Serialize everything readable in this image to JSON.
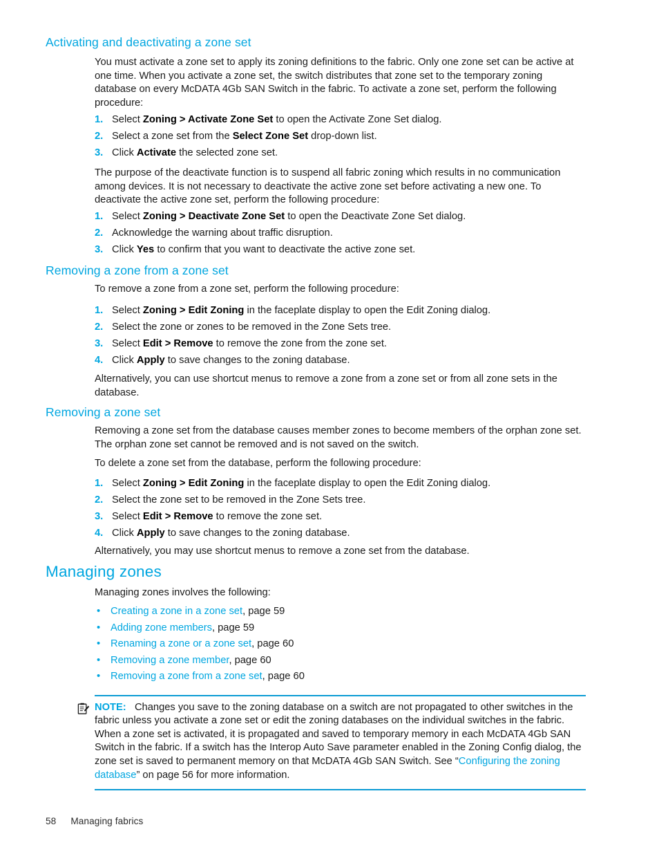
{
  "colors": {
    "accent": "#00a6e0",
    "rule": "#0a9bd4",
    "body_text": "#1a1a1a"
  },
  "sections": [
    {
      "id": "activating-deactivating",
      "heading": "Activating and deactivating a zone set",
      "intro": "You must activate a zone set to apply its zoning definitions to the fabric. Only one zone set can be active at one time. When you activate a zone set, the switch distributes that zone set to the temporary zoning database on every McDATA 4Gb SAN Switch in the fabric. To activate a zone set, perform the following procedure:",
      "steps": [
        {
          "num": "1.",
          "pre": "Select ",
          "bold": "Zoning > Activate Zone Set",
          "post": " to open the Activate Zone Set dialog."
        },
        {
          "num": "2.",
          "pre": "Select a zone set from the ",
          "bold": "Select Zone Set",
          "post": " drop-down list."
        },
        {
          "num": "3.",
          "pre": "Click ",
          "bold": "Activate",
          "post": " the selected zone set."
        }
      ],
      "middle": "The purpose of the deactivate function is to suspend all fabric zoning which results in no communication among devices. It is not necessary to deactivate the active zone set before activating a new one. To deactivate the active zone set, perform the following procedure:",
      "steps2": [
        {
          "num": "1.",
          "pre": "Select ",
          "bold": "Zoning > Deactivate Zone Set",
          "post": " to open the Deactivate Zone Set dialog."
        },
        {
          "num": "2.",
          "pre": "Acknowledge the warning about traffic disruption.",
          "bold": "",
          "post": ""
        },
        {
          "num": "3.",
          "pre": "Click ",
          "bold": "Yes",
          "post": " to confirm that you want to deactivate the active zone set."
        }
      ]
    },
    {
      "id": "removing-zone-from-zone-set",
      "heading": "Removing a zone from a zone set",
      "intro": "To remove a zone from a zone set, perform the following procedure:",
      "steps": [
        {
          "num": "1.",
          "pre": "Select ",
          "bold": "Zoning > Edit Zoning",
          "post": " in the faceplate display to open the Edit Zoning dialog."
        },
        {
          "num": "2.",
          "pre": "Select the zone or zones to be removed in the Zone Sets tree.",
          "bold": "",
          "post": ""
        },
        {
          "num": "3.",
          "pre": "Select ",
          "bold": "Edit > Remove",
          "post": " to remove the zone from the zone set."
        },
        {
          "num": "4.",
          "pre": "Click ",
          "bold": "Apply",
          "post": " to save changes to the zoning database."
        }
      ],
      "outro": "Alternatively, you can use shortcut menus to remove a zone from a zone set or from all zone sets in the database."
    },
    {
      "id": "removing-zone-set",
      "heading": "Removing a zone set",
      "intro": "Removing a zone set from the database causes member zones to become members of the orphan zone set. The orphan zone set cannot be removed and is not saved on the switch.",
      "intro2": "To delete a zone set from the database, perform the following procedure:",
      "steps": [
        {
          "num": "1.",
          "pre": "Select ",
          "bold": "Zoning > Edit Zoning",
          "post": " in the faceplate display to open the Edit Zoning dialog."
        },
        {
          "num": "2.",
          "pre": "Select the zone set to be removed in the Zone Sets tree.",
          "bold": "",
          "post": ""
        },
        {
          "num": "3.",
          "pre": "Select ",
          "bold": "Edit > Remove",
          "post": " to remove the zone set."
        },
        {
          "num": "4.",
          "pre": "Click ",
          "bold": "Apply",
          "post": " to save changes to the zoning database."
        }
      ],
      "outro": "Alternatively, you may use shortcut menus to remove a zone set from the database."
    }
  ],
  "managing_zones": {
    "heading": "Managing zones",
    "intro": "Managing zones involves the following:",
    "links": [
      {
        "label": "Creating a zone in a zone set",
        "page": ", page 59"
      },
      {
        "label": "Adding zone members",
        "page": ", page 59"
      },
      {
        "label": "Renaming a zone or a zone set",
        "page": ", page 60"
      },
      {
        "label": "Removing a zone member",
        "page": ", page 60"
      },
      {
        "label": "Removing a zone from a zone set",
        "page": ", page 60"
      }
    ]
  },
  "note": {
    "icon": "note-clipboard-icon",
    "label": "NOTE:",
    "text_part1": "Changes you save to the zoning database on a switch are not propagated to other switches in the fabric unless you activate a zone set or edit the zoning databases on the individual switches in the fabric. When a zone set is activated, it is propagated and saved to temporary memory in each McDATA 4Gb SAN Switch in the fabric. If a switch has the Interop Auto Save parameter enabled in the Zoning Config dialog, the zone set is saved to permanent memory on that McDATA 4Gb SAN Switch. See “",
    "link": "Configuring the zoning database",
    "text_part2": "” on page 56 for more information."
  },
  "footer": {
    "page_number": "58",
    "chapter": "Managing fabrics"
  }
}
